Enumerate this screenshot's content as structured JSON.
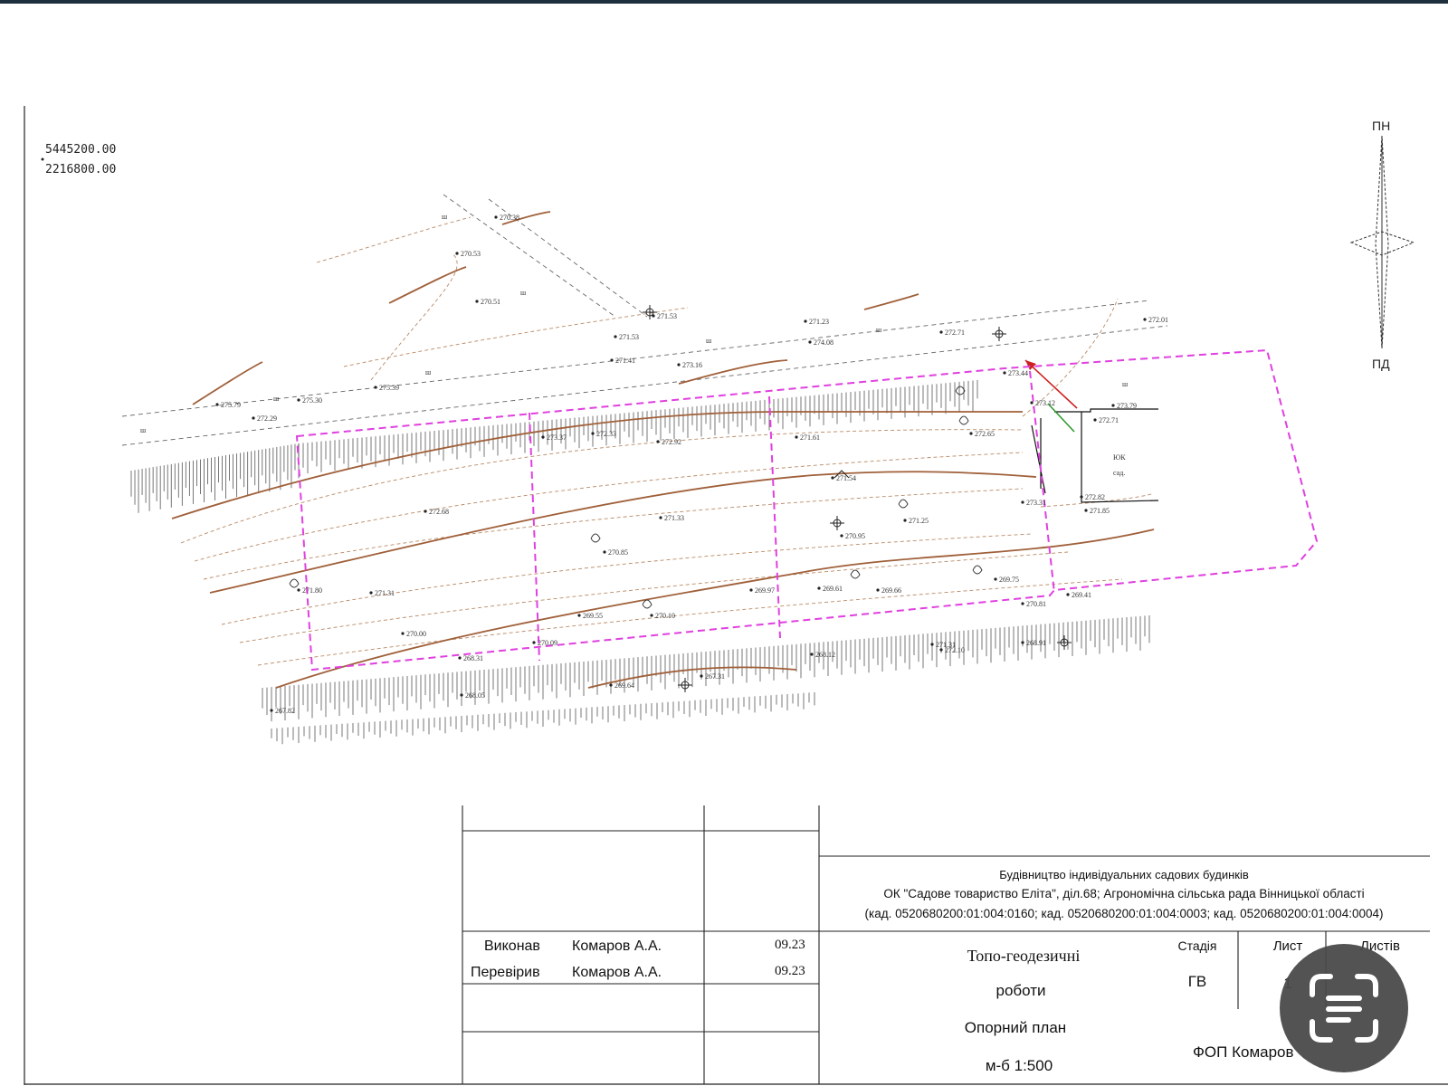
{
  "coords": {
    "line1": "5445200.00",
    "line2": "2216800.00"
  },
  "north_arrow": {
    "top": "ПН",
    "bottom": "ПД"
  },
  "map": {
    "building_label": "ЮК",
    "building_sub": "сад.",
    "small_labels": [
      "ш",
      "ш",
      "ш",
      "ш",
      "ш",
      "ш",
      "ш",
      "ш"
    ],
    "spot_heights": [
      "270.38",
      "270.53",
      "270.51",
      "271.53",
      "271.53",
      "271.23",
      "272.71",
      "272.01",
      "271.41",
      "273.16",
      "274.08",
      "275.39",
      "275.79",
      "275.30",
      "272.29",
      "273.37",
      "272.33",
      "272.92",
      "271.54",
      "272.68",
      "271.33",
      "270.85",
      "271.61",
      "270.95",
      "271.25",
      "269.97",
      "269.61",
      "269.66",
      "269.75",
      "270.00",
      "271.80",
      "271.31",
      "270.10",
      "269.55",
      "270.09",
      "269.64",
      "268.31",
      "268.12",
      "267.31",
      "273.12",
      "272.65",
      "273.44",
      "272.82",
      "272.71",
      "273.31",
      "273.79",
      "271.31",
      "271.85",
      "270.81",
      "269.41",
      "268.91",
      "268.05",
      "267.82",
      "272.10"
    ]
  },
  "title_block": {
    "project_line1": "Будівництво індивідуальних садових будинків",
    "project_line2": "ОК \"Садове товариство Еліта\", діл.68; Агрономічна сільська рада Вінницької області",
    "project_line3": "(кад. 0520680200:01:004:0160; кад. 0520680200:01:004:0003; кад. 0520680200:01:004:0004)",
    "rows": [
      {
        "role": "Виконав",
        "name": "Комаров А.А.",
        "date": "09.23"
      },
      {
        "role": "Перевірив",
        "name": "Комаров А.А.",
        "date": "09.23"
      }
    ],
    "work_title1": "Топо-геодезичні",
    "work_title2": "роботи",
    "plan_name": "Опорний план",
    "scale": "м-б 1:500",
    "stage_header": "Стадія",
    "sheet_header": "Лист",
    "sheets_header": "Листів",
    "stage_value": "ГВ",
    "sheet_value": "1",
    "org": "ФОП  Комаров"
  },
  "overlay": {
    "icon": "scan-text-icon",
    "color": "#484848"
  },
  "colors": {
    "contour": "#a0603a",
    "parcel": "#e040e0",
    "topbar": "#1d2f3d"
  }
}
